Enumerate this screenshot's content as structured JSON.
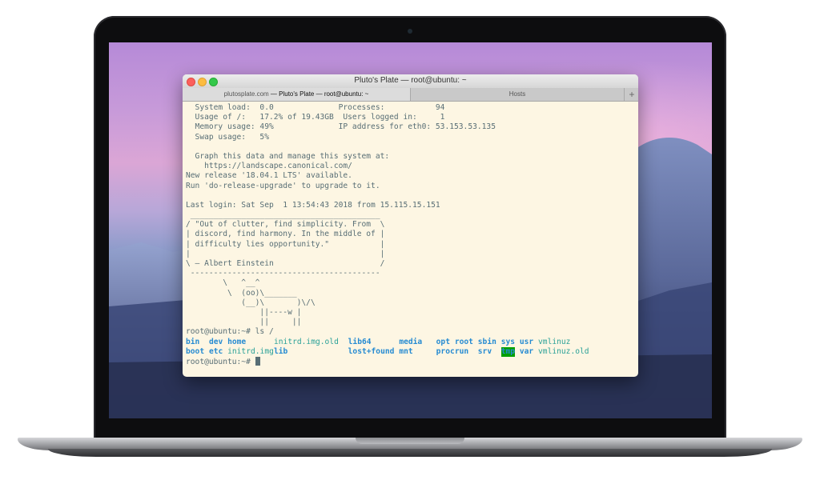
{
  "window": {
    "title": "Pluto's Plate — root@ubuntu: ~",
    "tabs": [
      {
        "host": "plutosplate.com",
        "label": " — Pluto's Plate — root@ubuntu: ~"
      },
      {
        "label": "Hosts"
      }
    ],
    "new_tab_label": "+"
  },
  "terminal": {
    "lines": [
      "  System load:  0.0              Processes:           94",
      "  Usage of /:   17.2% of 19.43GB  Users logged in:     1",
      "  Memory usage: 49%              IP address for eth0: 53.153.53.135",
      "  Swap usage:   5%",
      "",
      "  Graph this data and manage this system at:",
      "    https://landscape.canonical.com/",
      "New release '18.04.1 LTS' available.",
      "Run 'do-release-upgrade' to upgrade to it.",
      "",
      "Last login: Sat Sep  1 13:54:43 2018 from 15.115.15.151",
      " _________________________________________",
      "/ \"Out of clutter, find simplicity. From  \\",
      "| discord, find harmony. In the middle of |",
      "| difficulty lies opportunity.\"           |",
      "|                                         |",
      "\\ — Albert Einstein                       /",
      " -----------------------------------------",
      "        \\   ^__^",
      "         \\  (oo)\\_______",
      "            (__)\\       )\\/\\",
      "                ||----w |",
      "                ||     ||",
      "root@ubuntu:~# ls /"
    ],
    "ls_rows": [
      [
        {
          "text": "bin",
          "type": "dir"
        },
        {
          "text": "dev",
          "type": "dir"
        },
        {
          "text": "home",
          "type": "dir"
        },
        {
          "text": "initrd.img.old",
          "type": "link"
        },
        {
          "text": "lib64",
          "type": "dir"
        },
        {
          "text": "media",
          "type": "dir"
        },
        {
          "text": "opt",
          "type": "dir"
        },
        {
          "text": "root",
          "type": "dir"
        },
        {
          "text": "sbin",
          "type": "dir"
        },
        {
          "text": "sys",
          "type": "dir"
        },
        {
          "text": "usr",
          "type": "dir"
        },
        {
          "text": "vmlinuz",
          "type": "link"
        }
      ],
      [
        {
          "text": "boot",
          "type": "dir"
        },
        {
          "text": "etc",
          "type": "dir"
        },
        {
          "text": "initrd.img",
          "type": "link"
        },
        {
          "text": "lib",
          "type": "dir"
        },
        {
          "text": "lost+found",
          "type": "dir"
        },
        {
          "text": "mnt",
          "type": "dir"
        },
        {
          "text": "proc",
          "type": "dir"
        },
        {
          "text": "run",
          "type": "dir"
        },
        {
          "text": "srv",
          "type": "dir"
        },
        {
          "text": "tmp",
          "type": "tmp"
        },
        {
          "text": "var",
          "type": "dir"
        },
        {
          "text": "vmlinuz.old",
          "type": "link"
        }
      ]
    ],
    "prompt": "root@ubuntu:~# "
  },
  "colors": {
    "terminal_bg": "#fdf6e3",
    "terminal_fg": "#586e75",
    "dir": "#268bd2",
    "link": "#2aa198",
    "tmp_bg": "#00a000"
  },
  "icons": {
    "close": "close-icon",
    "minimize": "minimize-icon",
    "zoom": "zoom-icon"
  }
}
